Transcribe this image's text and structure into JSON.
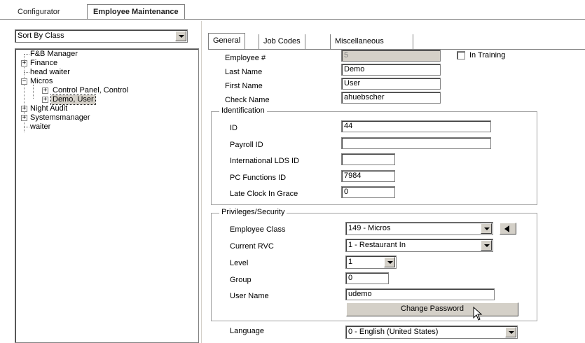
{
  "top_tabs": {
    "configurator": "Configurator",
    "employee_maintenance": "Employee Maintenance"
  },
  "sort": {
    "value": "Sort By Class"
  },
  "tree": {
    "items": [
      {
        "label": "F&B Manager"
      },
      {
        "label": "Finance"
      },
      {
        "label": "head waiter"
      },
      {
        "label": "Micros"
      },
      {
        "label": "Control Panel, Control"
      },
      {
        "label": "Demo, User"
      },
      {
        "label": "Night Audit"
      },
      {
        "label": "Systemsmanager"
      },
      {
        "label": "waiter"
      }
    ]
  },
  "tabs": {
    "general": "General",
    "job_codes": "Job Codes",
    "misc": "Miscellaneous"
  },
  "general": {
    "employee_num_label": "Employee #",
    "employee_num": "5",
    "in_training_label": "In Training",
    "last_name_label": "Last Name",
    "last_name": "Demo",
    "first_name_label": "First Name",
    "first_name": "User",
    "check_name_label": "Check Name",
    "check_name": "ahuebscher"
  },
  "identification": {
    "title": "Identification",
    "id_label": "ID",
    "id": "44",
    "payroll_label": "Payroll ID",
    "payroll": "",
    "intl_lds_label": "International LDS ID",
    "intl_lds": "",
    "pc_functions_label": "PC Functions ID",
    "pc_functions": "7984",
    "late_clock_label": "Late Clock In Grace",
    "late_clock": "0"
  },
  "privileges": {
    "title": "Privileges/Security",
    "emp_class_label": "Employee Class",
    "emp_class": "149 - Micros",
    "current_rvc_label": "Current RVC",
    "current_rvc": "1 - Restaurant In",
    "level_label": "Level",
    "level": "1",
    "group_label": "Group",
    "group": "0",
    "user_name_label": "User Name",
    "user_name": "udemo",
    "change_password": "Change Password"
  },
  "language": {
    "label": "Language",
    "value": "0 - English (United States)"
  },
  "icons": {
    "expand": "plus-expander-icon",
    "dropdown": "chevron-down-icon",
    "back": "left-triangle-icon",
    "cursor": "mouse-pointer-icon"
  },
  "colors": {
    "face": "#d4d0c8",
    "border_dark": "#808080",
    "window": "#ffffff"
  }
}
